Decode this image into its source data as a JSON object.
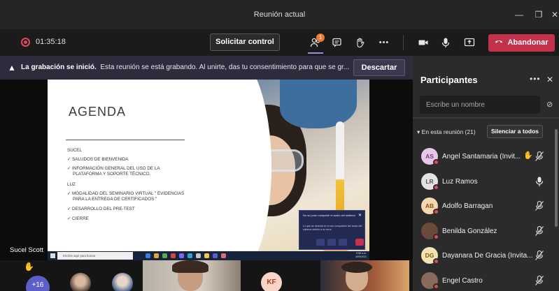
{
  "window": {
    "title": "Reunión actual",
    "minimize": "—",
    "maximize": "❐",
    "close": "✕"
  },
  "toolbar": {
    "timer": "01:35:18",
    "request_control": "Solicitar control",
    "participants_badge": "1",
    "more": "•••",
    "leave": "Abandonar",
    "colors": {
      "leave": "#c4314b",
      "recording": "#e4485a",
      "accent": "#8c8ef0"
    }
  },
  "banner": {
    "bold": "La grabación se inició.",
    "text": "Esta reunión se está grabando. Al unirte, das tu consentimiento para que se gr...",
    "dismiss": "Descartar"
  },
  "slide": {
    "title": "AGENDA",
    "lines": [
      "SUCEL",
      "✓  SALUDOS DE BIENVENIDA",
      "✓  INFORMACIÓN GENERAL DEL USO DE LA",
      "PLATAFORMA Y SOPORTE TÉCNICO.",
      "LUZ",
      "✓  MODALIDAD DEL SEMINARIO VIRTUAL \" EVIDENCIAS",
      "PARA LA ENTREGA DE CERTIFICADOS \"",
      "✓  DESARROLLO DEL PRE-TEST",
      "✓  CIERRE"
    ],
    "notification": {
      "title": "No se pudo compartir el audio del sistema",
      "body": "Lo que se detecta en el uso compartido del audio del sistema debido a un error."
    },
    "taskbar_search": "Escribe aquí para buscar",
    "taskbar_time": "9:58 a.m.",
    "taskbar_date": "4/09/2021",
    "presenter": "Sucel Scott"
  },
  "strip": {
    "overflow": "+16",
    "kf_initials": "KF"
  },
  "panel": {
    "title": "Participantes",
    "more": "•••",
    "close": "✕",
    "search_placeholder": "Escribe un nombre",
    "section": "En esta reunión (21)",
    "mute_all": "Silenciar a todos",
    "participants": [
      {
        "name": "Angel Santamaria (Invit...",
        "initials": "AS",
        "avatar_bg": "#e8c8e8",
        "avatar_fg": "#7a3b7a",
        "hand": true,
        "mic": "muted"
      },
      {
        "name": "Luz Ramos",
        "initials": "LR",
        "avatar_bg": "#e3e3e3",
        "avatar_fg": "#555555",
        "hand": false,
        "mic": "on"
      },
      {
        "name": "Adolfo Barragan",
        "initials": "AB",
        "avatar_bg": "#f5d7b0",
        "avatar_fg": "#8a5516",
        "hand": false,
        "mic": "muted"
      },
      {
        "name": "Benilda González",
        "initials": "",
        "avatar_bg": "#6b4a3c",
        "avatar_fg": "#ffffff",
        "hand": false,
        "mic": "muted"
      },
      {
        "name": "Dayanara De Gracia (Invita...",
        "initials": "DG",
        "avatar_bg": "#f4e3b5",
        "avatar_fg": "#7a5a12",
        "hand": false,
        "mic": "muted"
      },
      {
        "name": "Engel Castro",
        "initials": "",
        "avatar_bg": "#8a6a5a",
        "avatar_fg": "#ffffff",
        "hand": false,
        "mic": "muted"
      }
    ]
  }
}
